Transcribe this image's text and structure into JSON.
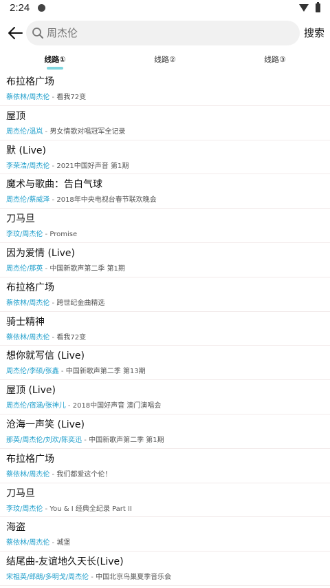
{
  "status_bar": {
    "time": "2:24"
  },
  "search": {
    "placeholder": "周杰伦",
    "button": "搜索"
  },
  "tabs": [
    {
      "label": "线路①"
    },
    {
      "label": "线路②"
    },
    {
      "label": "线路③"
    }
  ],
  "songs": [
    {
      "title": "布拉格广场",
      "artist": "蔡依林/周杰伦",
      "sep": " - ",
      "album": "看我72变"
    },
    {
      "title": "屋顶",
      "artist": "周杰伦/温岚",
      "sep": " - ",
      "album": "男女情歌对唱冠军全记录"
    },
    {
      "title": "默 (Live)",
      "artist": "李荣浩/周杰伦",
      "sep": " - ",
      "album": "2021中国好声音 第1期"
    },
    {
      "title": "魔术与歌曲：告白气球",
      "artist": "周杰伦/蔡威泽",
      "sep": " - ",
      "album": "2018年中央电视台春节联欢晚会"
    },
    {
      "title": "刀马旦",
      "artist": "李玟/周杰伦",
      "sep": " - ",
      "album": "Promise"
    },
    {
      "title": "因为爱情 (Live)",
      "artist": "周杰伦/那英",
      "sep": " - ",
      "album": "中国新歌声第二季 第1期"
    },
    {
      "title": "布拉格广场",
      "artist": "蔡依林/周杰伦",
      "sep": " - ",
      "album": "跨世纪金曲精选"
    },
    {
      "title": "骑士精神",
      "artist": "蔡依林/周杰伦",
      "sep": " - ",
      "album": "看我72变"
    },
    {
      "title": "想你就写信 (Live)",
      "artist": "周杰伦/李硕/张鑫",
      "sep": " - ",
      "album": "中国新歌声第二季 第13期"
    },
    {
      "title": "屋顶 (Live)",
      "artist": "周杰伦/宿涵/张神儿",
      "sep": " - ",
      "album": "2018中国好声音 澳门演唱会"
    },
    {
      "title": "沧海一声笑 (Live)",
      "artist": "那英/周杰伦/刘欢/陈奕迅",
      "sep": " - ",
      "album": "中国新歌声第二季 第1期"
    },
    {
      "title": "布拉格广场",
      "artist": "蔡依林/周杰伦",
      "sep": " - ",
      "album": "我们都爱这个伦！"
    },
    {
      "title": "刀马旦",
      "artist": "李玟/周杰伦",
      "sep": " - ",
      "album": "You & I 经典全纪录 Part II"
    },
    {
      "title": "海盗",
      "artist": "蔡依林/周杰伦",
      "sep": " - ",
      "album": "城堡"
    },
    {
      "title": "结尾曲-友谊地久天长(Live)",
      "artist": "宋祖英/郎朗/多明戈/周杰伦",
      "sep": " - ",
      "album": "中国北京鸟巢夏季音乐会"
    }
  ]
}
